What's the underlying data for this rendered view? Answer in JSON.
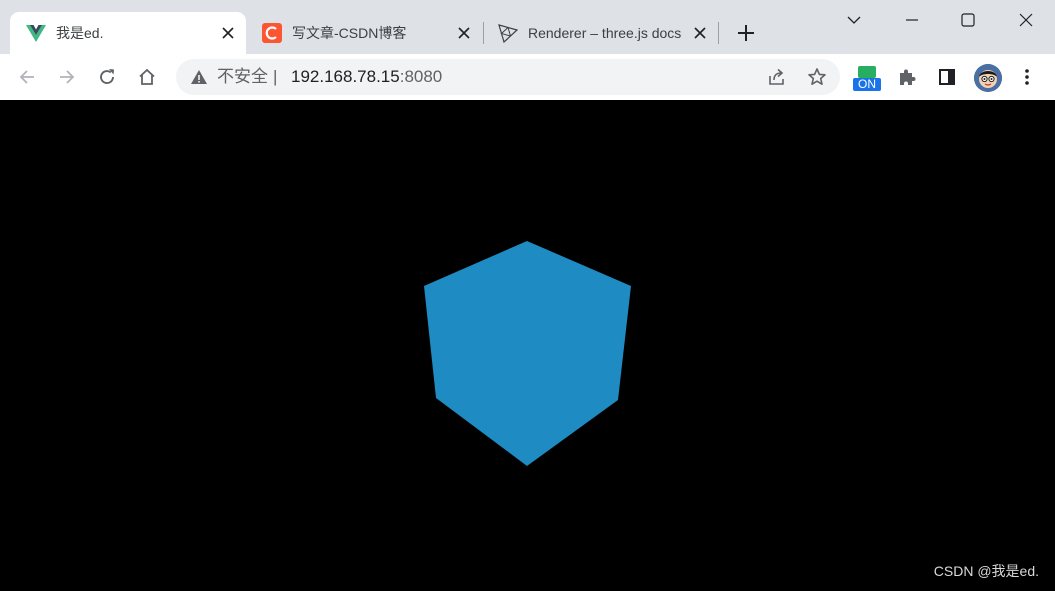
{
  "tabs": [
    {
      "title": "我是ed.",
      "favicon": "vue-logo-icon",
      "active": true
    },
    {
      "title": "写文章-CSDN博客",
      "favicon": "csdn-logo-icon",
      "active": false
    },
    {
      "title": "Renderer – three.js docs",
      "favicon": "threejs-logo-icon",
      "active": false
    }
  ],
  "omnibox": {
    "security_label": "不安全",
    "divider": "|",
    "host": "192.168.78.15",
    "port": ":8080"
  },
  "extension_badge": "ON",
  "scene": {
    "background": "#000000",
    "cube_color": "#1e8bc3"
  },
  "watermark": "CSDN @我是ed.",
  "colors": {
    "tabstrip_bg": "#dee1e6",
    "toolbar_bg": "#ffffff",
    "omnibox_bg": "#f1f3f4",
    "icon_color": "#5f6368"
  }
}
